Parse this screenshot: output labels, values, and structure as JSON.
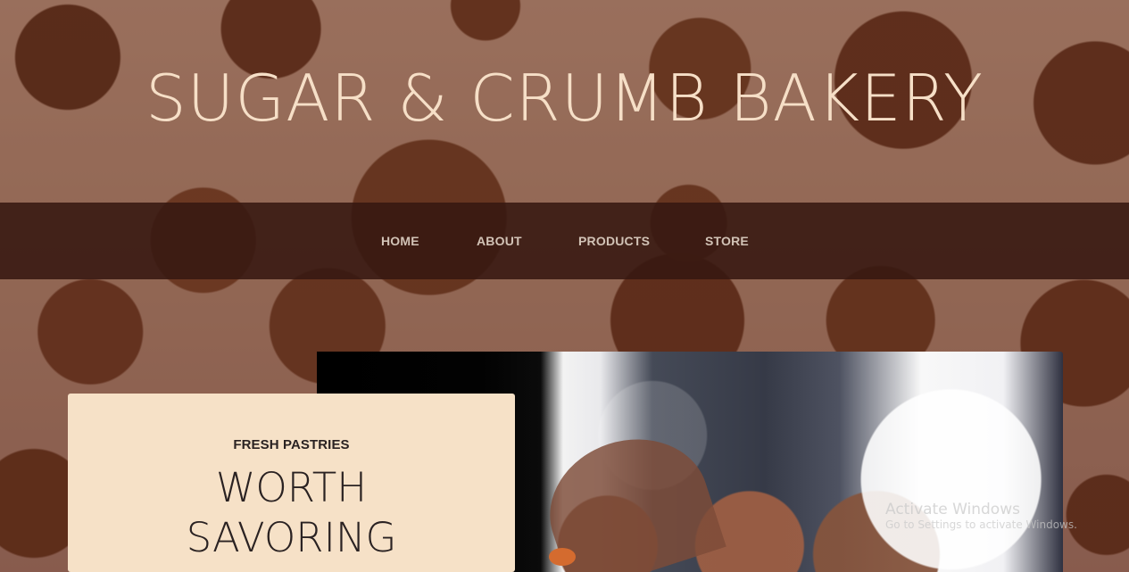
{
  "header": {
    "title": "SUGAR & CRUMB BAKERY"
  },
  "nav": {
    "items": [
      {
        "label": "HOME"
      },
      {
        "label": "ABOUT"
      },
      {
        "label": "PRODUCTS"
      },
      {
        "label": "STORE"
      }
    ]
  },
  "promo": {
    "kicker": "FRESH PASTRIES",
    "title_line_1": "WORTH",
    "title_line_2": "SAVORING"
  },
  "watermark": {
    "line_1": "Activate Windows",
    "line_2": "Go to Settings to activate Windows."
  },
  "colors": {
    "nav_background": "#371811",
    "title_text": "#f6dfc7",
    "card_background": "#f6e1c7",
    "card_text": "#2a2222"
  }
}
